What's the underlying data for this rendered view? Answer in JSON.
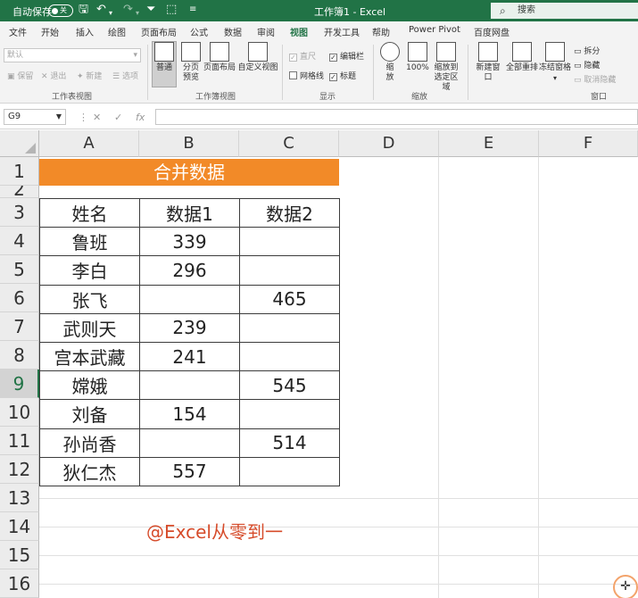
{
  "titlebar": {
    "autosave_label": "自动保存",
    "autosave_state": "关",
    "document_title": "工作簿1  -  Excel",
    "search_placeholder": "搜索"
  },
  "menu_tabs": [
    "文件",
    "开始",
    "插入",
    "绘图",
    "页面布局",
    "公式",
    "数据",
    "审阅",
    "视图",
    "开发工具",
    "帮助",
    "Power Pivot",
    "百度网盘"
  ],
  "active_tab": "视图",
  "ribbon": {
    "sheet_view": {
      "dropdown_value": "默认",
      "buttons": [
        "保留",
        "退出",
        "新建",
        "选项"
      ],
      "group_label": "工作表视图"
    },
    "workbook_views": {
      "buttons": [
        "普通",
        "分页预览",
        "页面布局",
        "自定义视图"
      ],
      "group_label": "工作簿视图"
    },
    "show": {
      "ruler": "直尺",
      "formula_bar": "编辑栏",
      "gridlines": "网格线",
      "headings": "标题",
      "group_label": "显示"
    },
    "zoom": {
      "buttons": [
        "缩放",
        "100%",
        "缩放到选定区域"
      ],
      "group_label": "缩放"
    },
    "window": {
      "buttons": [
        "新建窗口",
        "全部重排",
        "冻结窗格"
      ],
      "split": "拆分",
      "hide": "隐藏",
      "unhide": "取消隐藏",
      "group_label": "窗口"
    }
  },
  "formula_bar": {
    "name_box": "G9",
    "fx": "fx",
    "content": ""
  },
  "grid": {
    "columns": [
      "A",
      "B",
      "C",
      "D",
      "E",
      "F"
    ],
    "rows": [
      "1",
      "2",
      "3",
      "4",
      "5",
      "6",
      "7",
      "8",
      "9",
      "10",
      "11",
      "12",
      "13",
      "14",
      "15",
      "16"
    ],
    "selected_row": "9",
    "merged_title": "合并数据",
    "table_header": [
      "姓名",
      "数据1",
      "数据2"
    ],
    "table_rows": [
      [
        "鲁班",
        "339",
        ""
      ],
      [
        "李白",
        "296",
        ""
      ],
      [
        "张飞",
        "",
        "465"
      ],
      [
        "武则天",
        "239",
        ""
      ],
      [
        "宫本武藏",
        "241",
        ""
      ],
      [
        "嫦娥",
        "",
        "545"
      ],
      [
        "刘备",
        "154",
        ""
      ],
      [
        "孙尚香",
        "",
        "514"
      ],
      [
        "狄仁杰",
        "557",
        ""
      ]
    ],
    "watermark": "@Excel从零到一"
  },
  "colors": {
    "excel_green": "#217346",
    "title_orange": "#f28a28",
    "watermark_red": "#d64b2a"
  }
}
